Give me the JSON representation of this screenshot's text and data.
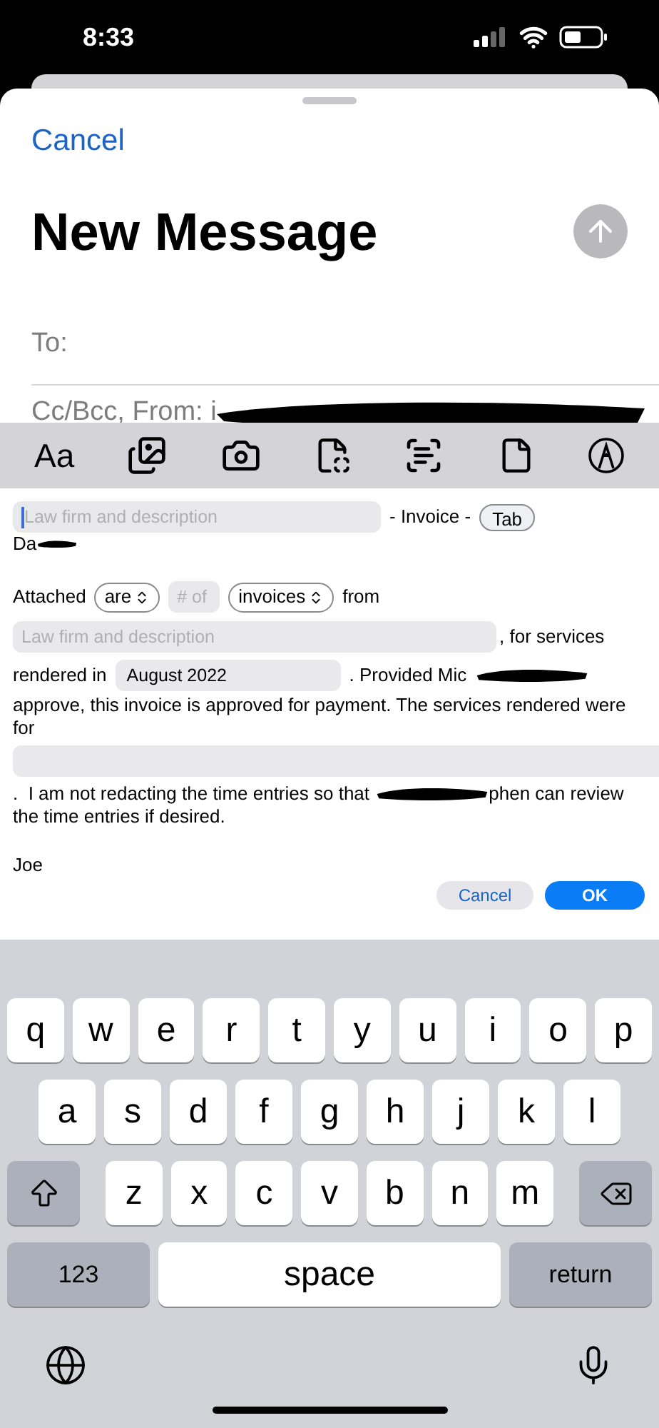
{
  "status_bar": {
    "time": "8:33"
  },
  "compose": {
    "cancel": "Cancel",
    "title": "New Message",
    "to_label": "To:",
    "cc_from": "Cc/Bcc, From: i"
  },
  "toolbar": {
    "format_label": "Aa"
  },
  "template": {
    "title_field": {
      "placeholder": "Law firm and description",
      "focused": true
    },
    "title_suffix": "- Invoice -",
    "tab_chip": "Tab",
    "greeting": "Da",
    "attached": "Attached",
    "verb_select": "are",
    "count_field": {
      "placeholder": "# of"
    },
    "noun_select": "invoices",
    "from": "from",
    "firm_field": {
      "placeholder": "Law firm and description"
    },
    "for_services": ", for services",
    "rendered_in": "rendered in",
    "date_field": {
      "value": "August 2022"
    },
    "provided": ".  Provided Mic",
    "approve_text": "approve, this invoice is approved for payment. The services rendered were for",
    "not_redacting": ".  I am not redacting the time entries so that",
    "can_review": "phen can review",
    "entries_line": "the time entries if desired.",
    "signoff": "Joe",
    "cancel": "Cancel",
    "ok": "OK"
  },
  "keyboard": {
    "rows": [
      [
        "q",
        "w",
        "e",
        "r",
        "t",
        "y",
        "u",
        "i",
        "o",
        "p"
      ],
      [
        "a",
        "s",
        "d",
        "f",
        "g",
        "h",
        "j",
        "k",
        "l"
      ],
      [
        "z",
        "x",
        "c",
        "v",
        "b",
        "n",
        "m"
      ]
    ],
    "numbers": "123",
    "space": "space",
    "return": "return"
  }
}
